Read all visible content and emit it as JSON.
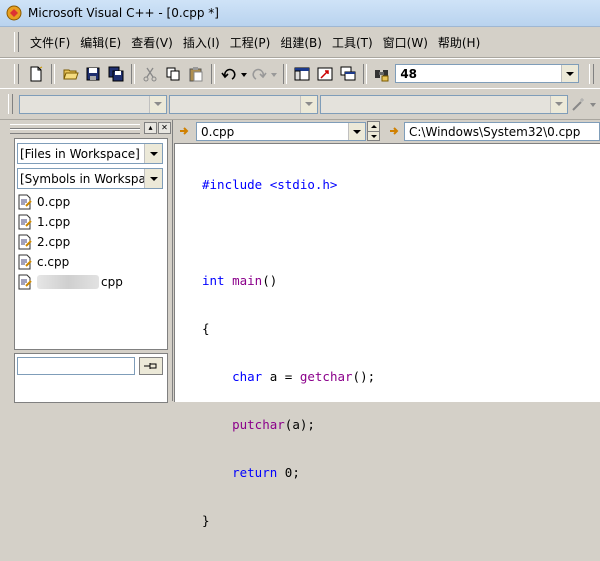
{
  "window": {
    "title": "Microsoft Visual C++ - [0.cpp *]"
  },
  "menu": {
    "items": [
      "文件(F)",
      "编辑(E)",
      "查看(V)",
      "插入(I)",
      "工程(P)",
      "组建(B)",
      "工具(T)",
      "窗口(W)",
      "帮助(H)"
    ]
  },
  "toolbar": {
    "find_value": "48",
    "icons": [
      "new-file-icon",
      "open-folder-icon",
      "save-icon",
      "save-all-icon",
      "cut-icon",
      "copy-icon",
      "paste-icon",
      "undo-icon",
      "redo-icon",
      "workspace-icon",
      "output-icon",
      "window-list-icon",
      "find-in-files-icon"
    ]
  },
  "workspace": {
    "dropdowns": [
      "[Files in Workspace]",
      "[Symbols in Workspac"
    ],
    "files": [
      "0.cpp",
      "1.cpp",
      "2.cpp",
      "c.cpp",
      "cpp"
    ]
  },
  "editor": {
    "file_combo": "0.cpp",
    "path_combo": "C:\\Windows\\System32\\0.cpp"
  },
  "code": {
    "line1_include": "#include <stdio.h>",
    "line2_kw": "int",
    "line2_fn": "main",
    "line2_rest": "()",
    "line3": "{",
    "line4_kw": "char",
    "line4_mid": " a = ",
    "line4_fn": "getchar",
    "line4_end": "();",
    "line5_fn": "putchar",
    "line5_end": "(a);",
    "line6_kw": "return",
    "line6_end": " 0;",
    "line7": "}"
  }
}
